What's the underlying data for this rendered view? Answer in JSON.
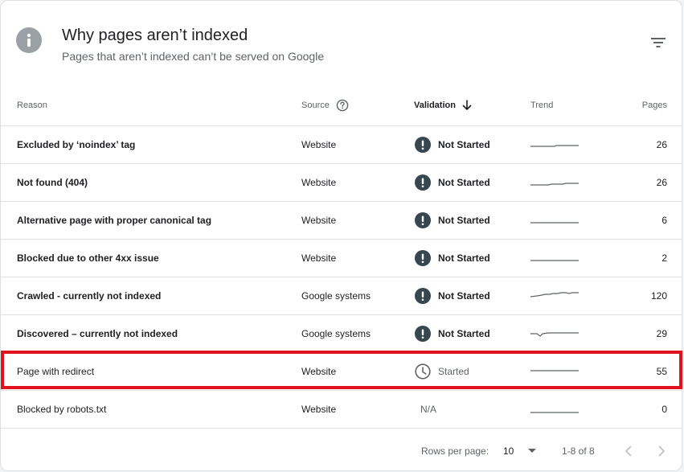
{
  "header": {
    "title": "Why pages aren’t indexed",
    "subtitle": "Pages that aren’t indexed can’t be served on Google",
    "info_icon": "info-icon",
    "filter_icon": "filter-icon"
  },
  "columns": {
    "reason": "Reason",
    "source": "Source",
    "source_help_icon": "help-circle-icon",
    "validation": "Validation",
    "validation_sort_icon": "arrow-down-icon",
    "trend": "Trend",
    "pages": "Pages"
  },
  "rows": [
    {
      "reason": "Excluded by ‘noindex’ tag",
      "source": "Website",
      "validation": "Not Started",
      "validation_icon": "exclamation-circle-icon",
      "pages": "26"
    },
    {
      "reason": "Not found (404)",
      "source": "Website",
      "validation": "Not Started",
      "validation_icon": "exclamation-circle-icon",
      "pages": "26"
    },
    {
      "reason": "Alternative page with proper canonical tag",
      "source": "Website",
      "validation": "Not Started",
      "validation_icon": "exclamation-circle-icon",
      "pages": "6"
    },
    {
      "reason": "Blocked due to other 4xx issue",
      "source": "Website",
      "validation": "Not Started",
      "validation_icon": "exclamation-circle-icon",
      "pages": "2"
    },
    {
      "reason": "Crawled - currently not indexed",
      "source": "Google systems",
      "validation": "Not Started",
      "validation_icon": "exclamation-circle-icon",
      "pages": "120"
    },
    {
      "reason": "Discovered – currently not indexed",
      "source": "Google systems",
      "validation": "Not Started",
      "validation_icon": "exclamation-circle-icon",
      "pages": "29"
    },
    {
      "reason": "Page with redirect",
      "source": "Website",
      "validation": "Started",
      "validation_icon": "clock-icon",
      "pages": "55"
    },
    {
      "reason": "Blocked by robots.txt",
      "source": "Website",
      "validation": "N/A",
      "validation_icon": "",
      "pages": "0"
    }
  ],
  "footer": {
    "rows_per_page_label": "Rows per page:",
    "rows_per_page_value": "10",
    "range": "1-8 of 8",
    "prev_icon": "chevron-left-icon",
    "next_icon": "chevron-right-icon"
  },
  "colors": {
    "status_icon": "#37474f",
    "highlight": "#e0141e",
    "sparkline": "#5f6368"
  }
}
